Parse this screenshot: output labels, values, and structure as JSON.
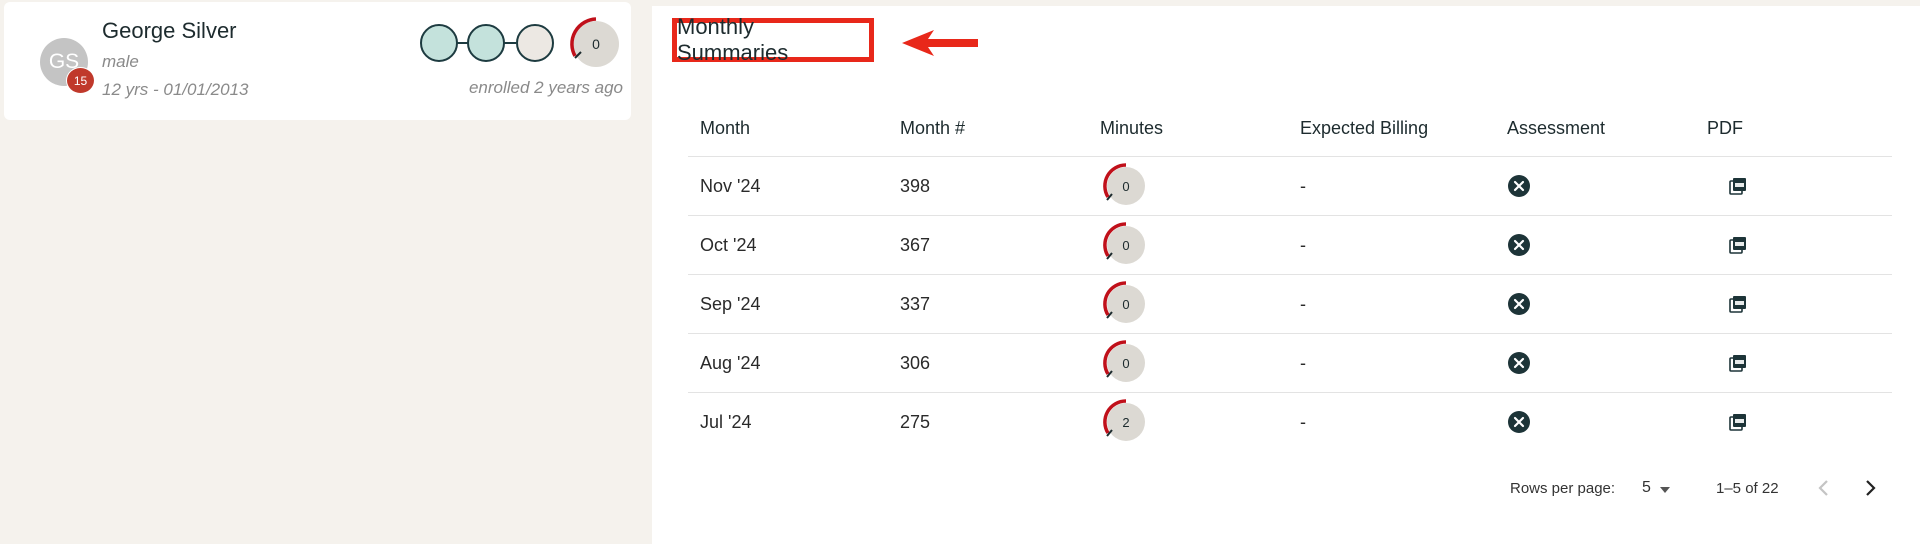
{
  "patient": {
    "initials": "GS",
    "badge_count": "15",
    "name": "George Silver",
    "gender": "male",
    "age_dob": "12 yrs - 01/01/2013",
    "enrolled": "enrolled 2 years ago",
    "minutes_value": "0",
    "steps_completed": 2,
    "steps_total": 3
  },
  "summary": {
    "title": "Monthly Summaries",
    "columns": [
      "Month",
      "Month #",
      "Minutes",
      "Expected Billing",
      "Assessment",
      "PDF"
    ],
    "rows": [
      {
        "month": "Nov '24",
        "month_num": "398",
        "minutes": "0",
        "billing": "-"
      },
      {
        "month": "Oct '24",
        "month_num": "367",
        "minutes": "0",
        "billing": "-"
      },
      {
        "month": "Sep '24",
        "month_num": "337",
        "minutes": "0",
        "billing": "-"
      },
      {
        "month": "Aug '24",
        "month_num": "306",
        "minutes": "0",
        "billing": "-"
      },
      {
        "month": "Jul '24",
        "month_num": "275",
        "minutes": "2",
        "billing": "-"
      }
    ],
    "pagination": {
      "rows_per_page_label": "Rows per page:",
      "rows_per_page": "5",
      "range": "1–5 of 22"
    }
  },
  "colors": {
    "accent_red": "#e8281a",
    "gauge_red": "#c0101a",
    "step_fill": "#c4e2dc",
    "dark": "#1d3b40"
  }
}
